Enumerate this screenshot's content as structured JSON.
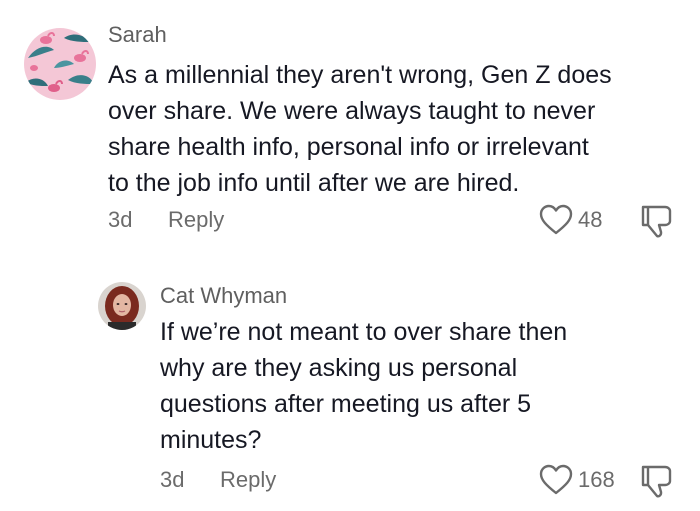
{
  "comments": [
    {
      "username": "Sarah",
      "text": "As a millennial they aren't wrong, Gen Z does\nover share. We were always taught to never\nshare health info, personal info or irrelevant\nto the job info until after we are hired.",
      "time": "3d",
      "reply_label": "Reply",
      "likes": "48",
      "avatar_icon": "flamingo-pattern-avatar"
    },
    {
      "username": "Cat Whyman",
      "text": "If we’re not meant to over share then\nwhy are they asking us personal\nquestions after meeting us after 5\nminutes?",
      "time": "3d",
      "reply_label": "Reply",
      "likes": "168",
      "avatar_icon": "profile-photo-avatar"
    }
  ],
  "icons": {
    "like": "heart-outline-icon",
    "dislike": "thumbs-down-outline-icon"
  },
  "colors": {
    "text": "#161823",
    "secondary": "#6b6b6b",
    "username": "#5f5f5f",
    "avatar1_bg": "#f4c7d6",
    "avatar1_leaf": "#3a7f8a",
    "avatar1_flamingo": "#e8739a",
    "avatar2_hair": "#7a2a1f",
    "avatar2_skin": "#e3b7a3"
  }
}
